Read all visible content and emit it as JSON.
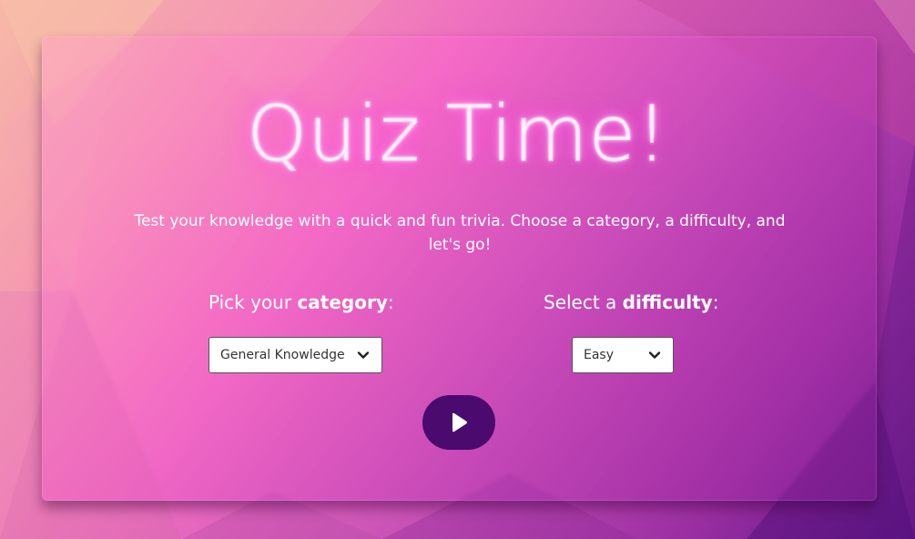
{
  "page": {
    "title": "Quiz Time!",
    "subtitle": "Test your knowledge with a quick and fun trivia. Choose a category, a difficulty, and let's go!"
  },
  "category": {
    "label_prefix": "Pick your ",
    "label_bold": "category",
    "label_suffix": ":",
    "selected": "General Knowledge"
  },
  "difficulty": {
    "label_prefix": "Select a ",
    "label_bold": "difficulty",
    "label_suffix": ":",
    "selected": "Easy"
  },
  "actions": {
    "play_icon": "play-icon"
  },
  "colors": {
    "play_button": "#4a0a6e",
    "title_glow": "#ff5fe0"
  }
}
